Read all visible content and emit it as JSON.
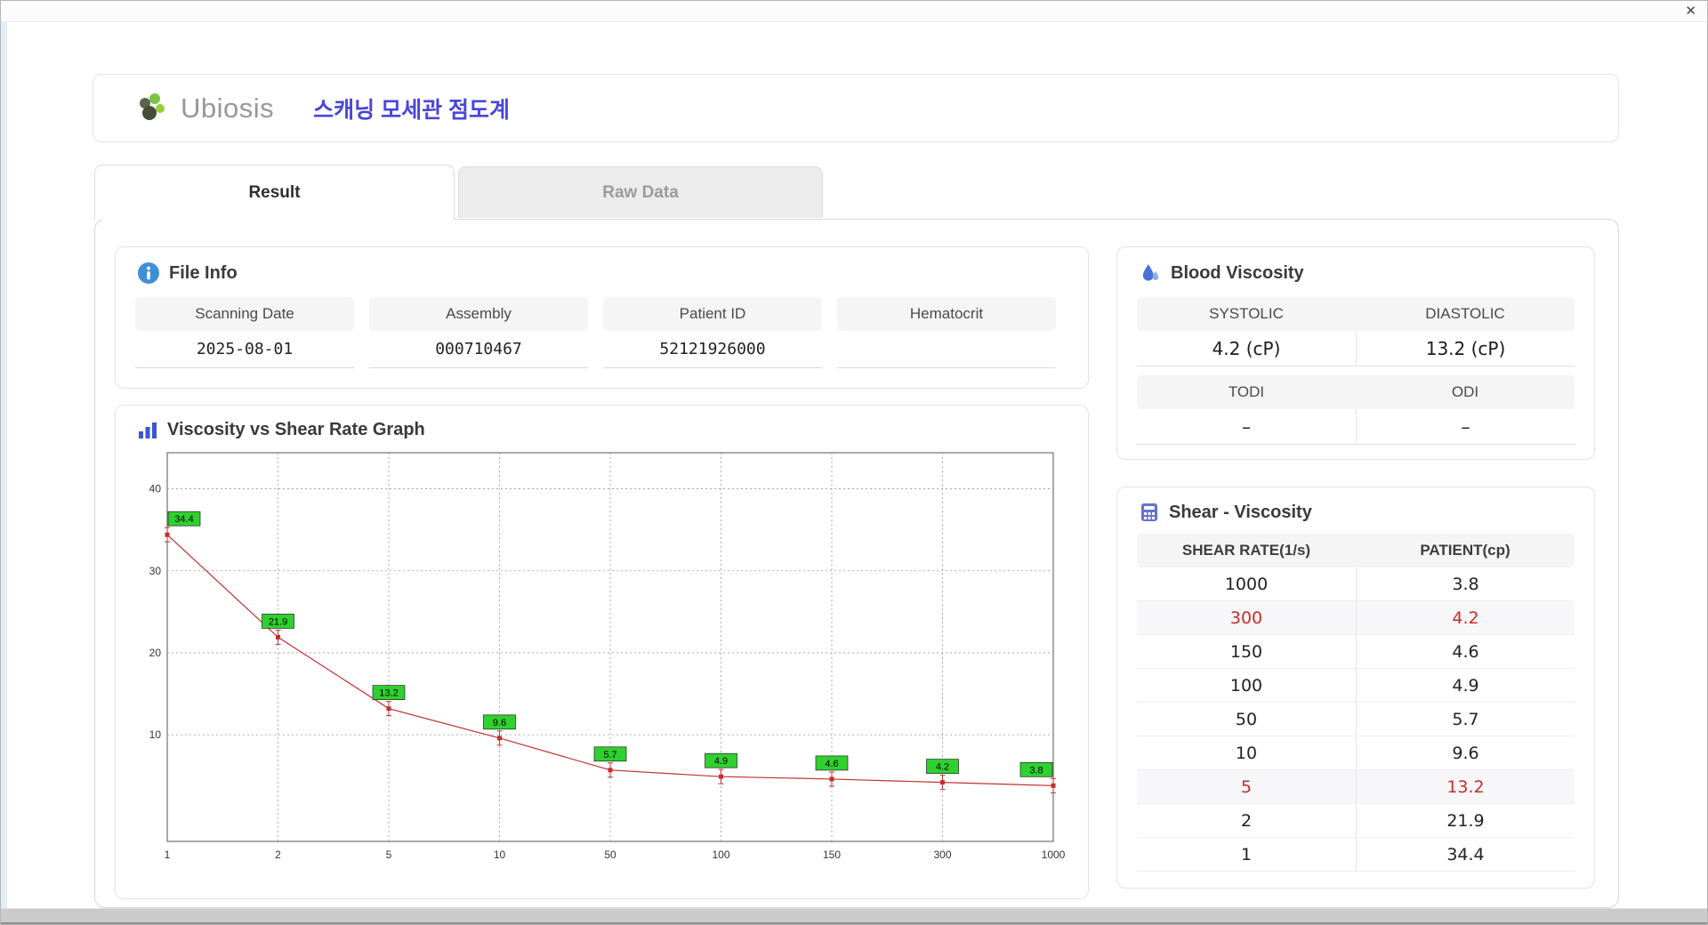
{
  "window": {
    "close_label": "✕"
  },
  "header": {
    "logo_text": "Ubiosis",
    "title": "스캐닝 모세관 점도계"
  },
  "tabs": [
    {
      "label": "Result",
      "active": true
    },
    {
      "label": "Raw Data",
      "active": false
    }
  ],
  "file_info": {
    "title": "File Info",
    "fields": [
      {
        "label": "Scanning Date",
        "value": "2025-08-01"
      },
      {
        "label": "Assembly",
        "value": "000710467"
      },
      {
        "label": "Patient ID",
        "value": "52121926000"
      },
      {
        "label": "Hematocrit",
        "value": ""
      }
    ]
  },
  "graph": {
    "title": "Viscosity vs Shear Rate Graph"
  },
  "chart_data": {
    "type": "line",
    "title": "Viscosity vs Shear Rate Graph",
    "xlabel": "",
    "ylabel": "",
    "categories": [
      "1",
      "2",
      "5",
      "10",
      "50",
      "100",
      "150",
      "300",
      "1000"
    ],
    "x": [
      1,
      2,
      5,
      10,
      50,
      100,
      150,
      300,
      1000
    ],
    "values": [
      34.4,
      21.9,
      13.2,
      9.6,
      5.7,
      4.9,
      4.6,
      4.2,
      3.8
    ],
    "point_labels": [
      "34.4",
      "21.9",
      "13.2",
      "9.6",
      "5.7",
      "4.9",
      "4.6",
      "4.2",
      "3.8"
    ],
    "yticks": [
      10,
      20,
      30,
      40
    ],
    "ylim": [
      -3,
      44.4
    ],
    "x_spacing": "equal",
    "grid": "dashed",
    "line_color": "#c03030",
    "marker_color": "#c03030",
    "label_bg_color": "#2fd12f",
    "label_text_color": "#000000"
  },
  "blood_viscosity": {
    "title": "Blood Viscosity",
    "rows": [
      {
        "h1": "SYSTOLIC",
        "h2": "DIASTOLIC",
        "v1": "4.2 (cP)",
        "v2": "13.2 (cP)"
      },
      {
        "h1": "TODI",
        "h2": "ODI",
        "v1": "–",
        "v2": "–"
      }
    ]
  },
  "shear_viscosity": {
    "title": "Shear - Viscosity",
    "columns": [
      "SHEAR RATE(1/s)",
      "PATIENT(cp)"
    ],
    "rows": [
      {
        "shear": "1000",
        "patient": "3.8",
        "highlight": false
      },
      {
        "shear": "300",
        "patient": "4.2",
        "highlight": true
      },
      {
        "shear": "150",
        "patient": "4.6",
        "highlight": false
      },
      {
        "shear": "100",
        "patient": "4.9",
        "highlight": false
      },
      {
        "shear": "50",
        "patient": "5.7",
        "highlight": false
      },
      {
        "shear": "10",
        "patient": "9.6",
        "highlight": false
      },
      {
        "shear": "5",
        "patient": "13.2",
        "highlight": true
      },
      {
        "shear": "2",
        "patient": "21.9",
        "highlight": false
      },
      {
        "shear": "1",
        "patient": "34.4",
        "highlight": false
      }
    ]
  }
}
